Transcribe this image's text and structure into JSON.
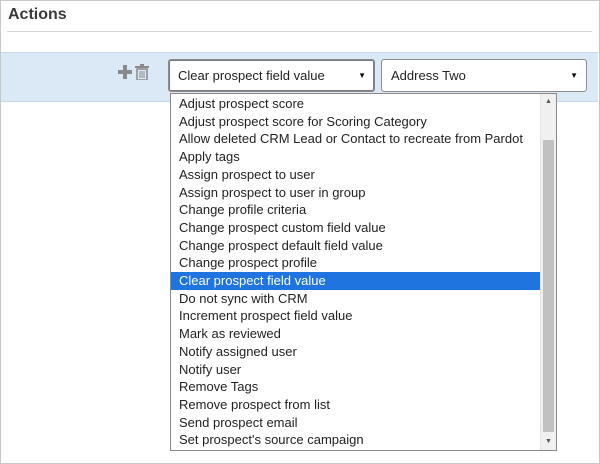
{
  "section": {
    "title": "Actions"
  },
  "row": {
    "add_icon": "plus-icon",
    "delete_icon": "trash-icon",
    "action_select_value": "Clear prospect field value",
    "field_select_value": "Address Two",
    "arrow_glyph": "▼"
  },
  "dropdown": {
    "options": [
      "Adjust prospect score",
      "Adjust prospect score for Scoring Category",
      "Allow deleted CRM Lead or Contact to recreate from Pardot",
      "Apply tags",
      "Assign prospect to user",
      "Assign prospect to user in group",
      "Change profile criteria",
      "Change prospect custom field value",
      "Change prospect default field value",
      "Change prospect profile",
      "Clear prospect field value",
      "Do not sync with CRM",
      "Increment prospect field value",
      "Mark as reviewed",
      "Notify assigned user",
      "Notify user",
      "Remove Tags",
      "Remove prospect from list",
      "Send prospect email",
      "Set prospect's source campaign"
    ],
    "selected_index": 10,
    "scroll_up_glyph": "▲",
    "scroll_down_glyph": "▼"
  },
  "colors": {
    "row_background": "#dbe9f7",
    "selected_option": "#1f74e0"
  }
}
